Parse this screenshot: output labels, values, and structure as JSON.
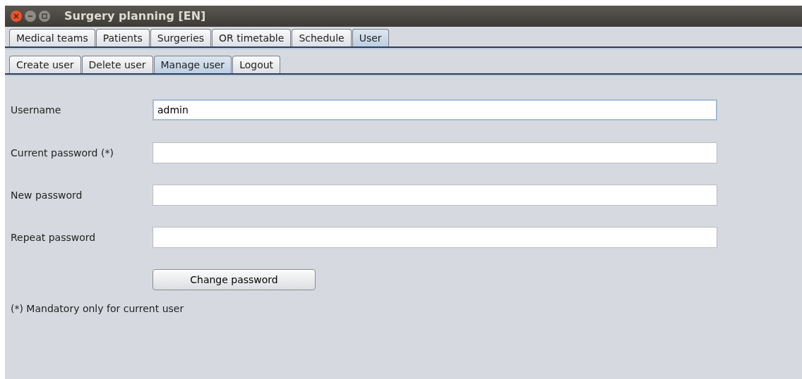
{
  "window": {
    "title": "Surgery planning [EN]"
  },
  "tabs": [
    {
      "label": "Medical teams",
      "selected": false
    },
    {
      "label": "Patients",
      "selected": false
    },
    {
      "label": "Surgeries",
      "selected": false
    },
    {
      "label": "OR timetable",
      "selected": false
    },
    {
      "label": "Schedule",
      "selected": false
    },
    {
      "label": "User",
      "selected": true
    }
  ],
  "subtabs": [
    {
      "label": "Create user",
      "selected": false
    },
    {
      "label": "Delete user",
      "selected": false
    },
    {
      "label": "Manage user",
      "selected": true
    },
    {
      "label": "Logout",
      "selected": false
    }
  ],
  "form": {
    "fields": [
      {
        "label": "Username",
        "value": "admin",
        "focused": true
      },
      {
        "label": "Current password (*)",
        "focused": false
      },
      {
        "label": "New password",
        "focused": false
      },
      {
        "label": "Repeat password",
        "focused": false
      }
    ],
    "button": "Change password",
    "note": "(*) Mandatory only for current user"
  }
}
